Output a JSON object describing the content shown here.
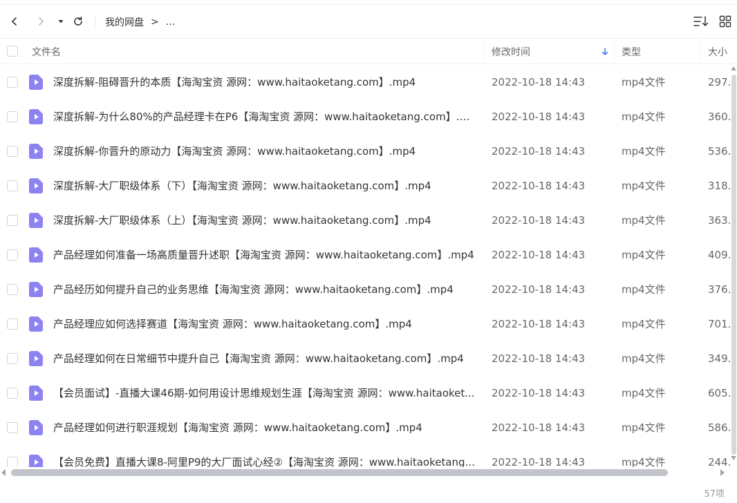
{
  "breadcrumb": {
    "root": "我的网盘",
    "separator": ">",
    "ellipsis": "..."
  },
  "header": {
    "filename": "文件名",
    "modified": "修改时间",
    "type": "类型",
    "size": "大小"
  },
  "colors": {
    "accent": "#4a7cf6",
    "file_icon": "#8c83f0",
    "text": "#333333",
    "muted": "#666666"
  },
  "rows": [
    {
      "name": "深度拆解-阻碍晋升的本质【海淘宝资 源网：www.haitaoketang.com】.mp4",
      "mtime": "2022-10-18 14:43",
      "type": "mp4文件",
      "size": "297."
    },
    {
      "name": "深度拆解-为什么80%的产品经理卡在P6【海淘宝资 源网：www.haitaoketang.com】.m...",
      "mtime": "2022-10-18 14:43",
      "type": "mp4文件",
      "size": "360."
    },
    {
      "name": "深度拆解-你晋升的原动力【海淘宝资 源网：www.haitaoketang.com】.mp4",
      "mtime": "2022-10-18 14:43",
      "type": "mp4文件",
      "size": "536."
    },
    {
      "name": "深度拆解-大厂职级体系（下）【海淘宝资 源网：www.haitaoketang.com】.mp4",
      "mtime": "2022-10-18 14:43",
      "type": "mp4文件",
      "size": "318."
    },
    {
      "name": "深度拆解-大厂职级体系（上）【海淘宝资 源网：www.haitaoketang.com】.mp4",
      "mtime": "2022-10-18 14:43",
      "type": "mp4文件",
      "size": "363."
    },
    {
      "name": "产品经理如何准备一场高质量晋升述职【海淘宝资 源网：www.haitaoketang.com】.mp4",
      "mtime": "2022-10-18 14:43",
      "type": "mp4文件",
      "size": "409."
    },
    {
      "name": "产品经历如何提升自己的业务思维【海淘宝资 源网：www.haitaoketang.com】.mp4",
      "mtime": "2022-10-18 14:43",
      "type": "mp4文件",
      "size": "376."
    },
    {
      "name": "产品经理应如何选择赛道【海淘宝资 源网：www.haitaoketang.com】.mp4",
      "mtime": "2022-10-18 14:43",
      "type": "mp4文件",
      "size": "701."
    },
    {
      "name": "产品经理如何在日常细节中提升自己【海淘宝资 源网：www.haitaoketang.com】.mp4",
      "mtime": "2022-10-18 14:43",
      "type": "mp4文件",
      "size": "349."
    },
    {
      "name": "【会员面试】-直播大课46期-如何用设计思维规划生涯【海淘宝资 源网：www.haitaoket...",
      "mtime": "2022-10-18 14:43",
      "type": "mp4文件",
      "size": "605."
    },
    {
      "name": "产品经理如何进行职涯规划【海淘宝资 源网：www.haitaoketang.com】.mp4",
      "mtime": "2022-10-18 14:43",
      "type": "mp4文件",
      "size": "586."
    },
    {
      "name": "【会员免费】直播大课8-阿里P9的大厂面试心经②【海淘宝资 源网：www.haitaoketang...",
      "mtime": "2022-10-18 14:43",
      "type": "mp4文件",
      "size": "244."
    }
  ],
  "footer": {
    "count": "57项"
  }
}
